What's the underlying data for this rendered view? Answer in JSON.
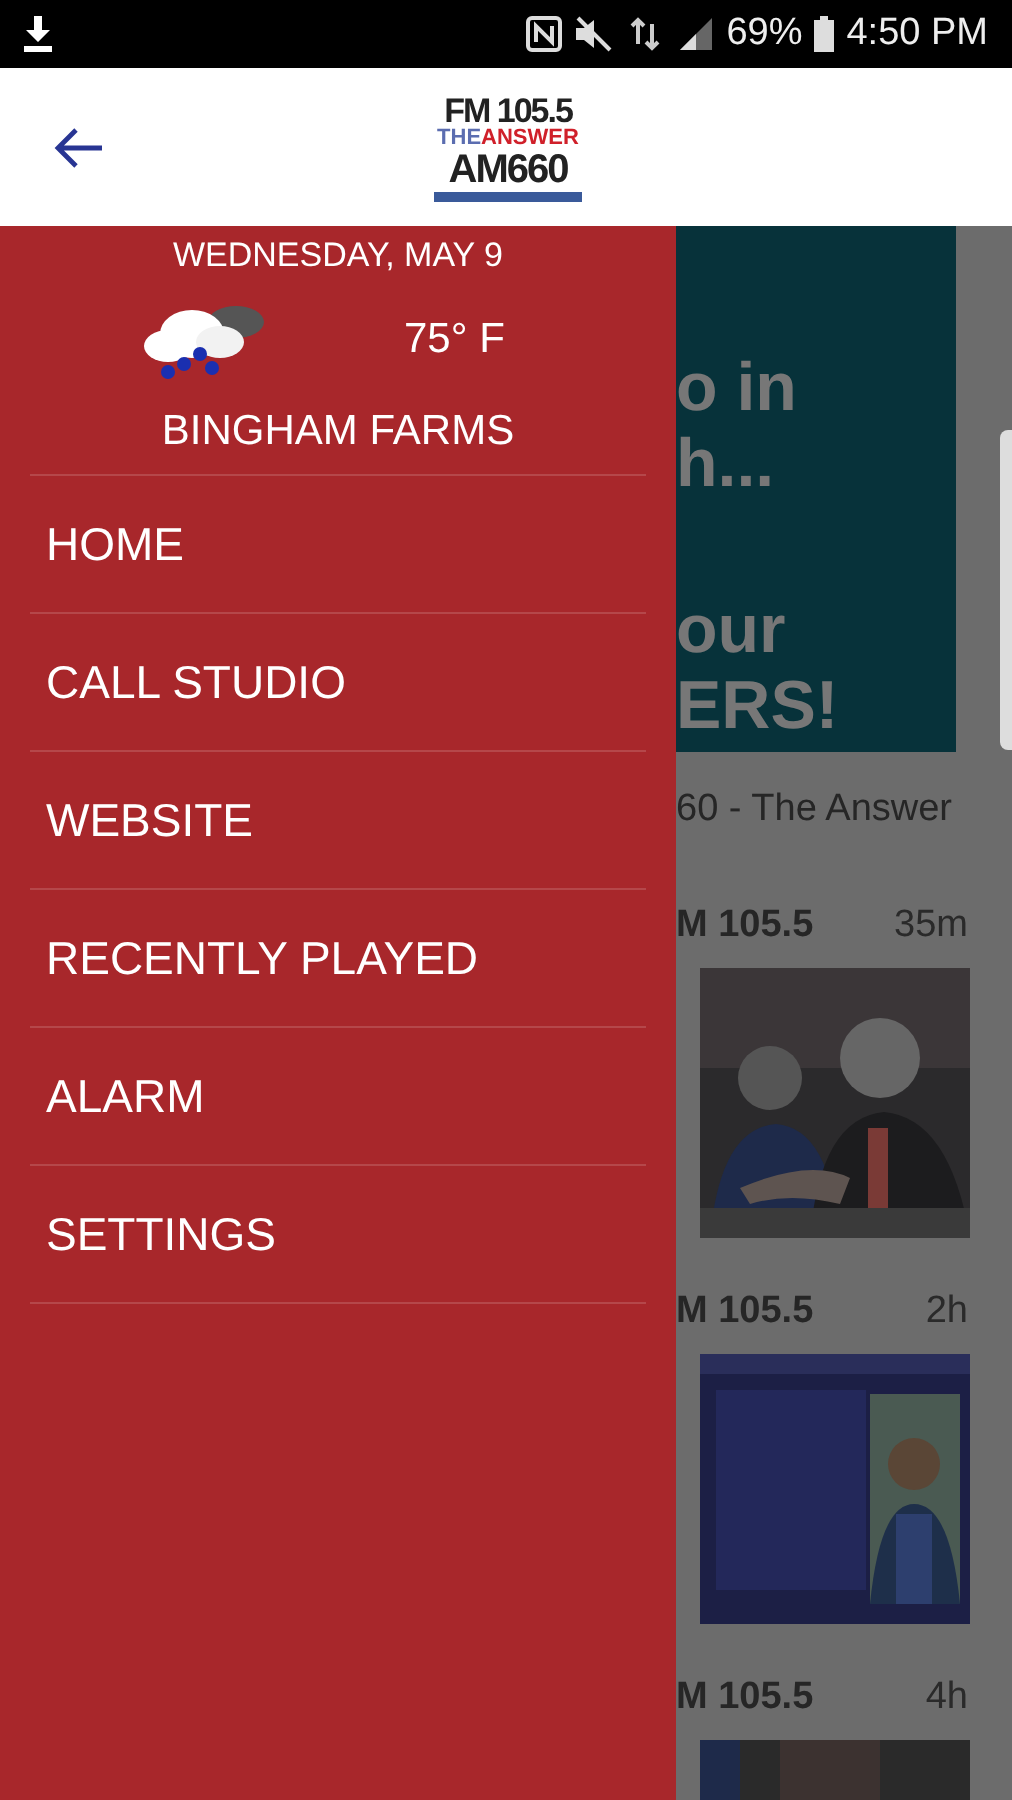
{
  "status_bar": {
    "battery": "69%",
    "time": "4:50 PM"
  },
  "app_bar": {
    "logo": {
      "line_1": "FM 105.5",
      "line_2_a": "THE",
      "line_2_b": "ANSWER",
      "line_3": "AM660"
    }
  },
  "drawer": {
    "date": "WEDNESDAY, MAY 9",
    "temperature": "75° F",
    "location": "BINGHAM FARMS",
    "items": [
      {
        "label": "HOME"
      },
      {
        "label": "CALL STUDIO"
      },
      {
        "label": "WEBSITE"
      },
      {
        "label": "RECENTLY PLAYED"
      },
      {
        "label": "ALARM"
      },
      {
        "label": "SETTINGS"
      }
    ]
  },
  "content": {
    "banner_lines": [
      "o in",
      "h...",
      "our",
      "ERS!"
    ],
    "station_name": "60 - The Answer",
    "posts": [
      {
        "source": "M 105.5",
        "age": "35m",
        "kind": "picture"
      },
      {
        "source": "M 105.5",
        "age": "2h",
        "kind": "picture"
      },
      {
        "source": "M 105.5",
        "age": "4h",
        "kind": "picture"
      }
    ]
  }
}
